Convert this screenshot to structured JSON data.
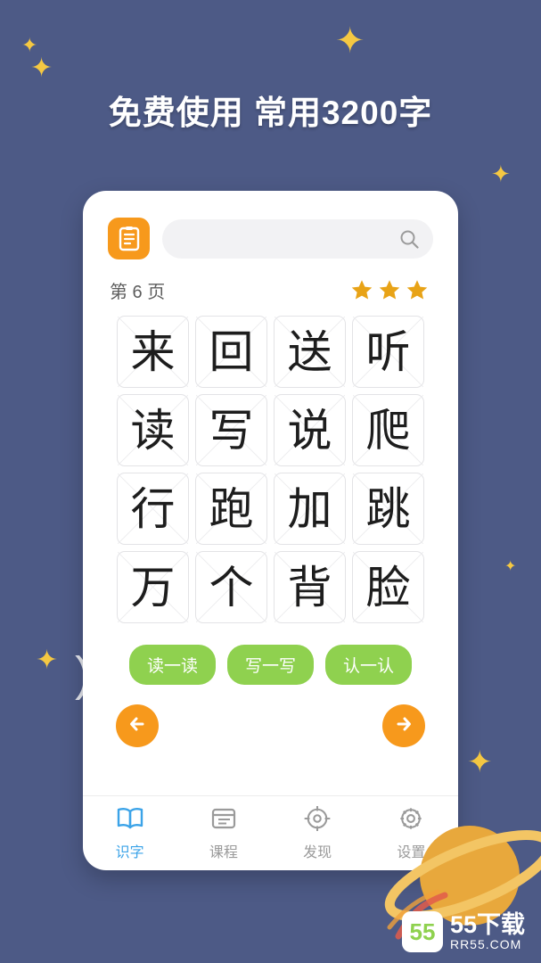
{
  "headline": "免费使用 常用3200字",
  "colors": {
    "background": "#4d5a86",
    "accent_orange": "#f7991c",
    "accent_green": "#8fd14f",
    "star_yellow": "#f5c842",
    "tab_active": "#3ba3e8"
  },
  "app": {
    "topbar": {
      "book_button_icon": "book-icon",
      "search_placeholder": "",
      "search_icon": "search-icon"
    },
    "page_row": {
      "page_label": "第 6 页",
      "stars": 3
    },
    "characters": [
      "来",
      "回",
      "送",
      "听",
      "读",
      "写",
      "说",
      "爬",
      "行",
      "跑",
      "加",
      "跳",
      "万",
      "个",
      "背",
      "脸"
    ],
    "actions": [
      {
        "label": "读一读"
      },
      {
        "label": "写一写"
      },
      {
        "label": "认一认"
      }
    ],
    "nav": {
      "prev_icon": "arrow-left-icon",
      "next_icon": "arrow-right-icon"
    },
    "tabs": [
      {
        "label": "识字",
        "icon": "book-open-icon",
        "active": true
      },
      {
        "label": "课程",
        "icon": "lesson-card-icon",
        "active": false
      },
      {
        "label": "发现",
        "icon": "compass-icon",
        "active": false
      },
      {
        "label": "设置",
        "icon": "gear-icon",
        "active": false
      }
    ]
  },
  "watermark": {
    "badge": "55",
    "main": "55下载",
    "sub": "RR55.COM"
  }
}
